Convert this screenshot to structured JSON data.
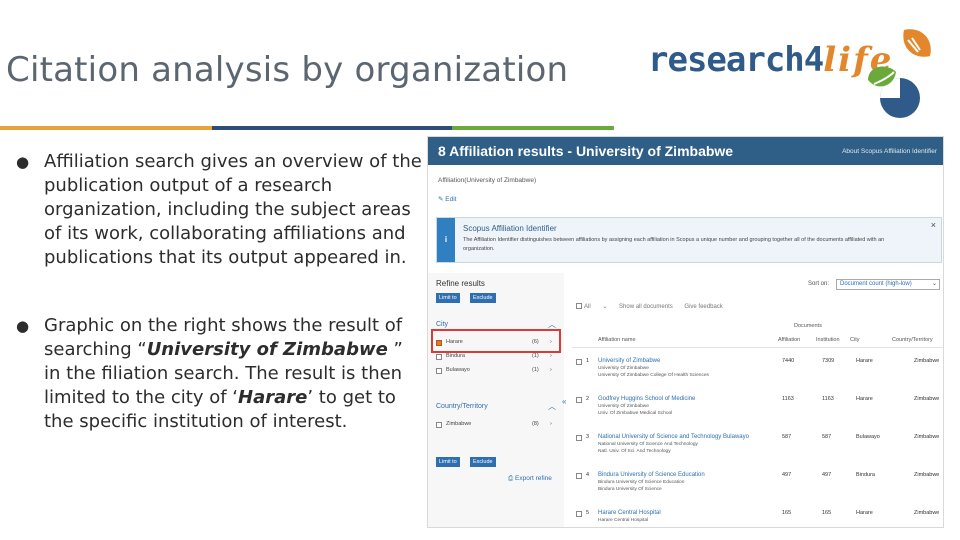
{
  "slide": {
    "title": "Citation analysis by organization",
    "colors": {
      "rule_orange": "#e9a23b",
      "rule_navy": "#2e4b7a",
      "rule_green": "#6aaa3a",
      "scopus_header": "#2f5f86"
    }
  },
  "logo": {
    "part1": "research",
    "part2": "4",
    "part3": "life"
  },
  "bullets": [
    {
      "text": "Affiliation search gives an overview of the publication output of a research organization, including the subject areas of its work, collaborating affiliations and publications that its output appeared in."
    },
    {
      "pre": "Graphic on the right shows the result of searching “",
      "em1": "University of Zimbabwe",
      "mid": " ” in the filiation search.  The result is then limited to the city of ‘",
      "em2": "Harare",
      "post": "’ to get to the specific institution of interest."
    }
  ],
  "scopus": {
    "header_title": "8 Affiliation results - University of Zimbabwe",
    "header_link": "About Scopus Affiliation Identifier",
    "affiliation_query": "Affiliation(University of Zimbabwe)",
    "edit": "Edit",
    "info_title": "Scopus Affiliation Identifier",
    "info_text": "The Affiliation Identifier distinguishes between affiliations by assigning each affiliation in Scopus a unique number and grouping together all of the documents affiliated with an organization.",
    "info_badge": "i",
    "refine_title": "Refine results",
    "limit_to": "Limit to",
    "exclude": "Exclude",
    "city_label": "City",
    "city_items": [
      {
        "name": "Harare",
        "count": "(6)",
        "checked": true
      },
      {
        "name": "Bindura",
        "count": "(1)",
        "checked": false
      },
      {
        "name": "Bulawayo",
        "count": "(1)",
        "checked": false
      }
    ],
    "country_label": "Country/Territory",
    "country_items": [
      {
        "name": "Zimbabwe",
        "count": "(8)",
        "checked": false
      }
    ],
    "export_refine": "Export refine",
    "sort_on_label": "Sort on:",
    "sort_value": "Document count (high-low)",
    "toolbar": {
      "all": "All",
      "show_all_documents": "Show all documents",
      "give_feedback": "Give feedback"
    },
    "columns": {
      "documents": "Documents",
      "affiliation_name": "Affiliation name",
      "affiliation": "Affiliation",
      "institution": "Institution",
      "city": "City",
      "country": "Country/Territory"
    },
    "rows": [
      {
        "num": "1",
        "name": "University of Zimbabwe",
        "sub": [
          "University Of Zimbabwe",
          "University Of Zimbabwe College Of Health Sciences"
        ],
        "docs": "7440",
        "inst": "7309",
        "city": "Harare",
        "country": "Zimbabwe"
      },
      {
        "num": "2",
        "name": "Godfrey Huggins School of Medicine",
        "sub": [
          "University Of Zimbabwe",
          "Univ. Of Zimbabwe Medical School"
        ],
        "docs": "1163",
        "inst": "1163",
        "city": "Harare",
        "country": "Zimbabwe"
      },
      {
        "num": "3",
        "name": "National University of Science and Technology Bulawayo",
        "sub": [
          "National University Of Science And Technology",
          "Natl. Univ. Of Sci. And Technology"
        ],
        "docs": "587",
        "inst": "587",
        "city": "Bulawayo",
        "country": "Zimbabwe"
      },
      {
        "num": "4",
        "name": "Bindura University of Science Education",
        "sub": [
          "Bindura University Of Science Education",
          "Bindura University Of Science"
        ],
        "docs": "497",
        "inst": "497",
        "city": "Bindura",
        "country": "Zimbabwe"
      },
      {
        "num": "5",
        "name": "Harare Central Hospital",
        "sub": [
          "Harare Central Hospital"
        ],
        "docs": "165",
        "inst": "165",
        "city": "Harare",
        "country": "Zimbabwe"
      }
    ]
  }
}
